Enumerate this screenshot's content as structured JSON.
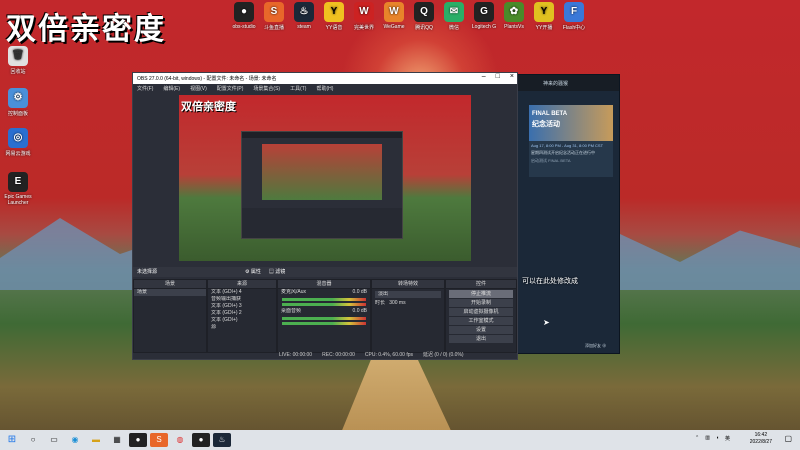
{
  "watermark": "双倍亲密度",
  "desktop_icons": [
    {
      "label": "回收站",
      "glyph": "🗑",
      "color": "#e0e0e0"
    },
    {
      "label": "控制面板",
      "glyph": "⚙",
      "color": "#4a90d9"
    },
    {
      "label": "网易云游戏",
      "glyph": "◎",
      "color": "#2a6fd0"
    },
    {
      "label": "Epic Games Launcher",
      "glyph": "E",
      "color": "#222"
    }
  ],
  "top_icons": [
    {
      "label": "obs-studio",
      "glyph": "●",
      "color": "#222"
    },
    {
      "label": "斗鱼直播",
      "glyph": "S",
      "color": "#e8672a"
    },
    {
      "label": "steam",
      "glyph": "♨",
      "color": "#1b2838"
    },
    {
      "label": "YY语音",
      "glyph": "Y",
      "color": "#f0c020"
    },
    {
      "label": "完美世界",
      "glyph": "W",
      "color": "#cc2222"
    },
    {
      "label": "WeGame",
      "glyph": "W",
      "color": "#e8842a"
    },
    {
      "label": "腾讯QQ",
      "glyph": "Q",
      "color": "#222"
    },
    {
      "label": "微信",
      "glyph": "✉",
      "color": "#2aae67"
    },
    {
      "label": "Logitech G",
      "glyph": "G",
      "color": "#222"
    },
    {
      "label": "PlantsVs",
      "glyph": "✿",
      "color": "#4a8a2a"
    },
    {
      "label": "YY开播",
      "glyph": "Y",
      "color": "#e0c020"
    },
    {
      "label": "Flash中心",
      "glyph": "F",
      "color": "#3a78d8"
    }
  ],
  "obs": {
    "title": "OBS 27.0.0 (64-bit, windows) - 配置文件: 未命名 - 场景: 未命名",
    "menu": [
      "文件(F)",
      "编辑(E)",
      "视图(V)",
      "配置文件(P)",
      "场景集合(S)",
      "工具(T)",
      "帮助(H)"
    ],
    "no_source": "未选择源",
    "props": "属性",
    "filters": "滤镜",
    "docks": {
      "scenes": "场景",
      "sources": "来源",
      "mixer": "混音器",
      "transitions": "转场特效",
      "controls": "控件"
    },
    "scene_items": [
      "场景"
    ],
    "source_items": [
      "文本 (GDI+) 4",
      "音频输出捕获",
      "文本 (GDI+) 3",
      "文本 (GDI+) 2",
      "文本 (GDI+)",
      "源"
    ],
    "mixer_items": [
      {
        "name": "麦克风/Aux",
        "db": "0.0 dB"
      },
      {
        "name": "桌面音频",
        "db": "0.0 dB"
      }
    ],
    "transition": {
      "type": "淡出",
      "duration_label": "时长",
      "duration": "300 ms"
    },
    "controls": [
      "停止推流",
      "开始录制",
      "启动虚拟摄像机",
      "工作室模式",
      "设置",
      "退出"
    ],
    "status": {
      "live": "LIVE: 00:00:00",
      "rec": "REC: 00:00:00",
      "cpu": "CPU: 0.4%, 60.00 fps",
      "dropped": "延迟 (0 / 0) (0.0%)"
    }
  },
  "steam": {
    "user": "神来的骚猴",
    "event_title": "FINAL BETA",
    "event_sub": "纪念活动",
    "event_date": "Aug 17, 8:00 PM - Aug 31, 8:00 PM CST",
    "event_note": "星期四测试开启纪念活动正在进行中",
    "game_label": "启动测试 FINAL BETA",
    "bottom": "添加好友"
  },
  "overlay_text": "可以在此处修改成",
  "taskbar": {
    "search": "搜索",
    "tray_lang": "英",
    "time": "16:42",
    "date": "2022/8/27"
  }
}
